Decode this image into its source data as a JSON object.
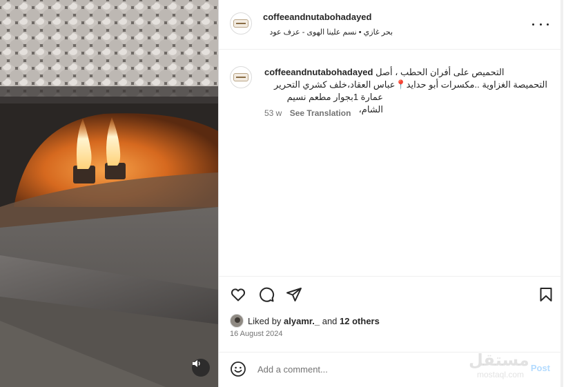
{
  "post": {
    "username": "coffeeandnutabohadayed",
    "location": "بحر غازي • نسم علينا الهوى - عزف عود",
    "caption": {
      "line1": "التحميص على أفران الحطب ، أصل",
      "line2": "التحميصة الغزاوية ..مكسرات أبو حدايد📍عباس العقاد،خلف كشري التحرير",
      "line3": "عمارة 1بجوار مطعم نسيم الشام،",
      "age": "53 w",
      "translate": "See Translation"
    },
    "likes": {
      "prefix": "Liked by",
      "user": "alyamr._",
      "conjunction": "and",
      "others": "12 others"
    },
    "date": "16 August 2024",
    "comment": {
      "placeholder": "Add a comment...",
      "post_label": "Post"
    }
  },
  "watermark": {
    "arabic": "مستقل",
    "latin": "mostaql.com"
  },
  "icons": {
    "more": "more-horizontal-icon",
    "like": "heart-icon",
    "comment": "comment-bubble-icon",
    "share": "paper-plane-icon",
    "save": "bookmark-icon",
    "emoji": "smiley-icon",
    "audio": "speaker-icon"
  },
  "colors": {
    "post_button_disabled": "#b3dbff",
    "secondary_text": "#737373",
    "primary_text": "#262626"
  }
}
